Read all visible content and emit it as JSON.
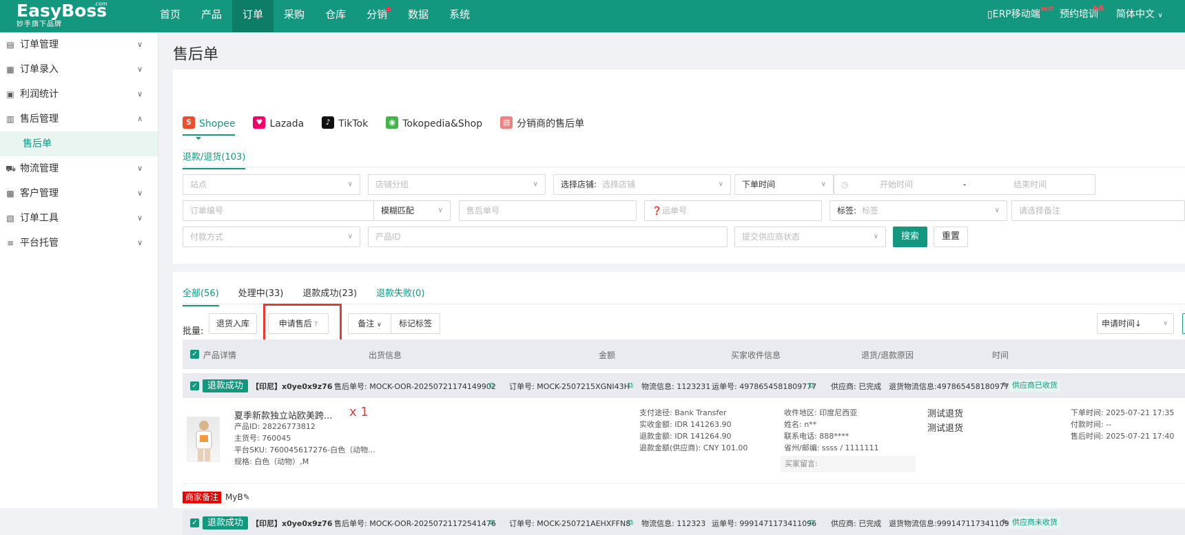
{
  "brand": {
    "name": "EasyBoss",
    "com": ".com",
    "subtitle": "妙手旗下品牌"
  },
  "topnav": {
    "items": [
      "首页",
      "产品",
      "订单",
      "采购",
      "仓库",
      "分销",
      "数据",
      "系统"
    ],
    "active_index": 2,
    "erp_mobile": "ERP移动端",
    "hot_tag": "HOT",
    "training": "预约培训",
    "free_tag": "免费",
    "language": "简体中文"
  },
  "sidebar": {
    "items": [
      {
        "label": "订单管理",
        "icon": "order-icon"
      },
      {
        "label": "订单录入",
        "icon": "order-entry-icon"
      },
      {
        "label": "利润统计",
        "icon": "profit-icon"
      },
      {
        "label": "售后管理",
        "icon": "aftersale-icon",
        "expanded": true
      },
      {
        "label": "售后单",
        "sub": true
      },
      {
        "label": "物流管理",
        "icon": "truck-icon"
      },
      {
        "label": "客户管理",
        "icon": "customer-icon"
      },
      {
        "label": "订单工具",
        "icon": "tool-icon"
      },
      {
        "label": "平台托管",
        "icon": "hosting-icon"
      }
    ]
  },
  "page": {
    "title": "售后单"
  },
  "platform_tabs": [
    {
      "label": "Shopee",
      "color": "#ee4d2d",
      "glyph": "S"
    },
    {
      "label": "Lazada",
      "color": "#f5006a",
      "glyph": "♥"
    },
    {
      "label": "TikTok",
      "color": "#111111",
      "glyph": "♪"
    },
    {
      "label": "Tokopedia&Shop",
      "color": "#42b549",
      "glyph": "◉"
    },
    {
      "label": "分销商的售后单",
      "color": "#f08080",
      "glyph": "▤"
    }
  ],
  "sub_tab": "退款/退货(103)",
  "filters": {
    "site": "站点",
    "shop_group": "店铺分组",
    "select_shop_label": "选择店铺:",
    "select_shop": "选择店铺",
    "order_time": "下单时间",
    "start_time": "开始时间",
    "dash": "-",
    "end_time": "结束时间",
    "order_no": "订单编号",
    "fuzzy": "模糊匹配",
    "aftersale_no": "售后单号",
    "tracking_no": "运单号",
    "tag_label": "标签:",
    "tag": "标签",
    "remark": "请选择备注",
    "payment": "付款方式",
    "product_id": "产品ID",
    "supplier_status": "提交供应商状态",
    "search_btn": "搜索",
    "reset_btn": "重置"
  },
  "status_tabs": [
    "全部(56)",
    "处理中(33)",
    "退款成功(23)",
    "退款失败(0)"
  ],
  "batch": {
    "label": "批量:",
    "return_stock": "退货入库",
    "apply_aftersale": "申请售后",
    "remark": "备注",
    "mark_tag": "标记标签",
    "sort": "申请时间↓"
  },
  "table_headers": [
    "产品详情",
    "出货信息",
    "金额",
    "买家收件信息",
    "退货/退款原因",
    "时间"
  ],
  "orders": [
    {
      "status": "退款成功",
      "shop": "【印尼】x0ye0x9z76",
      "aftersale_no": "售后单号: MOCK-OOR-20250721174149902",
      "order_no": "订单号: MOCK-2507215XGNI43H",
      "logistics": "物流信息: 1123231",
      "tracking": "运单号: 4978654581809777",
      "supplier": "供应商: 已完成",
      "return_logistics": "退货物流信息:4978654581809777",
      "supplier_tag": "供应商已收货",
      "product": {
        "name": "夏季新款独立站欧美跨...",
        "qty": "x 1",
        "id": "产品ID: 28226773812",
        "main_no": "主货号: 760045",
        "sku": "平台SKU: 760045617276-白色（动物...",
        "spec": "规格: 白色（动物）,M"
      },
      "amount": {
        "pay": "支付途径: Bank Transfer",
        "received": "实收金额: IDR 141263.90",
        "refund": "退款金额: IDR 141264.90",
        "refund_supplier": "退款金额(供应商): CNY 101.00"
      },
      "buyer": {
        "region": "收件地区: 印度尼西亚",
        "name": "姓名: n**",
        "phone": "联系电话: 888****",
        "zip": "省州/邮编: ssss / 1111111",
        "message": "买家留言:"
      },
      "reasons": [
        "测试退货",
        "测试退货"
      ],
      "times": {
        "order": "下单时间: 2025-07-21 17:35",
        "pay": "付款时间: --",
        "aftersale": "售后时间: 2025-07-21 17:40"
      },
      "merchant_note_tag": "商家备注",
      "merchant_note": "MyB"
    },
    {
      "status": "退款成功",
      "shop": "【印尼】x0ye0x9z76",
      "aftersale_no": "售后单号: MOCK-OOR-20250721172541476",
      "order_no": "订单号: MOCK-250721AEHXFFN8",
      "logistics": "物流信息: 112323",
      "tracking": "运单号: 9991471173411096",
      "supplier": "供应商: 已完成",
      "return_logistics": "退货物流信息:9991471173411096",
      "supplier_tag": "供应商未收货"
    }
  ]
}
